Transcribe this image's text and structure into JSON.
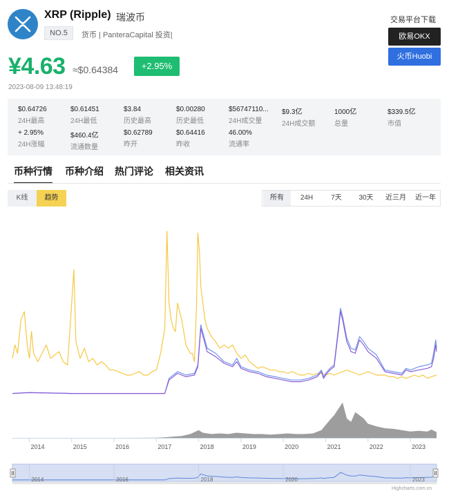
{
  "coin": {
    "name": "XRP (Ripple)",
    "cn_name": "瑞波币",
    "rank": "NO.5",
    "tags": "货币 | PanteraCapital 投资|"
  },
  "price": {
    "cny": "¥4.63",
    "usd": "≈$0.64384",
    "change": "+2.95%",
    "timestamp": "2023-08-09 13:48:19"
  },
  "exchange": {
    "title": "交易平台下载",
    "buttons": [
      "欧易OKX",
      "火币Huobi"
    ]
  },
  "stats": [
    {
      "value": "$0.64726",
      "label": "24H最高"
    },
    {
      "value": "$0.61451",
      "label": "24H最低"
    },
    {
      "value": "$3.84",
      "label": "历史最高"
    },
    {
      "value": "$0.00280",
      "label": "历史最低"
    },
    {
      "value": "$56747110...",
      "label": "24H成交量"
    },
    {
      "value": "$9.3亿",
      "label": "24H成交额"
    },
    {
      "value": "1000亿",
      "label": "总量"
    },
    {
      "value": "$339.5亿",
      "label": "市值"
    },
    {
      "value": "+ 2.95%",
      "label": "24H涨幅"
    },
    {
      "value": "$460.4亿",
      "label": "流通数量"
    },
    {
      "value": "$0.62789",
      "label": "昨开"
    },
    {
      "value": "$0.64416",
      "label": "昨收"
    },
    {
      "value": "46.00%",
      "label": "流通率"
    }
  ],
  "tabs": [
    "币种行情",
    "币种介绍",
    "热门评论",
    "相关资讯"
  ],
  "view_toggle": [
    "K线",
    "趋势"
  ],
  "ranges": [
    "所有",
    "24H",
    "7天",
    "30天",
    "近三月",
    "近一年"
  ],
  "colors": {
    "green": "#19b06b",
    "badge_green": "#1fbd72",
    "yellow": "#f5c842",
    "purple": "#8a5cd8",
    "blue": "#6f96e8",
    "volume": "#999999",
    "navigator_band": "#d2dcf2"
  },
  "chart_data": {
    "type": "line",
    "x_axis_ticks": [
      "2014",
      "2015",
      "2016",
      "2017",
      "2018",
      "2019",
      "2020",
      "2021",
      "2022",
      "2023"
    ],
    "navigator_ticks": [
      "2014",
      "2016",
      "2018",
      "2020",
      "2023"
    ],
    "x_range": [
      2013.6,
      2023.62
    ],
    "y_range": [
      0,
      100
    ],
    "series": [
      {
        "color": "#f5c842",
        "x": [
          2013.6,
          2013.66,
          2013.72,
          2013.8,
          2013.88,
          2013.95,
          2014.0,
          2014.05,
          2014.1,
          2014.2,
          2014.3,
          2014.4,
          2014.5,
          2014.6,
          2014.7,
          2014.8,
          2014.9,
          2015.0,
          2015.05,
          2015.1,
          2015.2,
          2015.3,
          2015.4,
          2015.5,
          2015.6,
          2015.7,
          2015.8,
          2015.9,
          2016.0,
          2016.1,
          2016.2,
          2016.3,
          2016.4,
          2016.5,
          2016.6,
          2016.7,
          2016.8,
          2016.9,
          2017.0,
          2017.1,
          2017.2,
          2017.25,
          2017.3,
          2017.35,
          2017.4,
          2017.45,
          2017.5,
          2017.6,
          2017.7,
          2017.8,
          2017.85,
          2017.9,
          2017.95,
          2017.98,
          2018.02,
          2018.05,
          2018.1,
          2018.15,
          2018.2,
          2018.3,
          2018.4,
          2018.5,
          2018.6,
          2018.7,
          2018.8,
          2018.9,
          2019.0,
          2019.1,
          2019.2,
          2019.3,
          2019.4,
          2019.5,
          2019.6,
          2019.7,
          2019.8,
          2019.9,
          2020.0,
          2020.1,
          2020.2,
          2020.3,
          2020.4,
          2020.5,
          2020.6,
          2020.7,
          2020.8,
          2020.9,
          2021.0,
          2021.1,
          2021.2,
          2021.3,
          2021.4,
          2021.5,
          2021.6,
          2021.7,
          2021.8,
          2021.9,
          2022.0,
          2022.1,
          2022.2,
          2022.3,
          2022.4,
          2022.5,
          2022.6,
          2022.7,
          2022.8,
          2022.9,
          2023.0,
          2023.1,
          2023.2,
          2023.3,
          2023.4,
          2023.5,
          2023.62
        ],
        "values": [
          22,
          30,
          25,
          45,
          50,
          30,
          22,
          38,
          25,
          20,
          25,
          30,
          22,
          24,
          26,
          20,
          18,
          55,
          75,
          32,
          22,
          28,
          20,
          22,
          18,
          20,
          18,
          15,
          15,
          14,
          13,
          12,
          12,
          13,
          14,
          12,
          12,
          14,
          15,
          25,
          40,
          98,
          55,
          45,
          40,
          38,
          55,
          45,
          30,
          25,
          25,
          20,
          55,
          97,
          85,
          65,
          55,
          45,
          40,
          35,
          32,
          28,
          30,
          28,
          30,
          25,
          22,
          24,
          20,
          18,
          16,
          17,
          16,
          15,
          15,
          14,
          14,
          13,
          14,
          13,
          12,
          12,
          13,
          12,
          13,
          13,
          12,
          13,
          12,
          13,
          14,
          15,
          14,
          13,
          12,
          13,
          14,
          13,
          12,
          12,
          12,
          11,
          11,
          10,
          11,
          10,
          11,
          12,
          11,
          12,
          10,
          11,
          12
        ]
      },
      {
        "color": "#6f96e8",
        "x": [
          2013.6,
          2014.0,
          2015.0,
          2016.0,
          2016.9,
          2017.2,
          2017.3,
          2017.5,
          2017.7,
          2017.9,
          2017.98,
          2018.05,
          2018.2,
          2018.4,
          2018.6,
          2018.8,
          2018.9,
          2019.0,
          2019.2,
          2019.4,
          2019.6,
          2019.8,
          2020.0,
          2020.2,
          2020.4,
          2020.6,
          2020.8,
          2020.9,
          2020.95,
          2021.0,
          2021.1,
          2021.2,
          2021.3,
          2021.35,
          2021.4,
          2021.5,
          2021.6,
          2021.7,
          2021.8,
          2021.9,
          2022.0,
          2022.2,
          2022.4,
          2022.6,
          2022.8,
          2022.9,
          2023.0,
          2023.2,
          2023.4,
          2023.5,
          2023.55,
          2023.6,
          2023.62
        ],
        "values": [
          1,
          1.5,
          1,
          1,
          1,
          1,
          10,
          14,
          12,
          13,
          18,
          42,
          28,
          25,
          20,
          18,
          22,
          17,
          15,
          14,
          12,
          11,
          10,
          9,
          9,
          10,
          12,
          15,
          11,
          13,
          16,
          18,
          40,
          52,
          47,
          34,
          28,
          27,
          35,
          32,
          28,
          24,
          15,
          14,
          13,
          16,
          15,
          17,
          18,
          19,
          25,
          33,
          28
        ]
      },
      {
        "color": "#8a5cd8",
        "x": [
          2013.6,
          2014.0,
          2015.0,
          2016.0,
          2016.9,
          2017.2,
          2017.3,
          2017.5,
          2017.7,
          2017.9,
          2017.98,
          2018.05,
          2018.2,
          2018.4,
          2018.6,
          2018.8,
          2018.9,
          2019.0,
          2019.2,
          2019.4,
          2019.6,
          2019.8,
          2020.0,
          2020.2,
          2020.4,
          2020.6,
          2020.8,
          2020.9,
          2020.95,
          2021.0,
          2021.1,
          2021.2,
          2021.3,
          2021.35,
          2021.4,
          2021.5,
          2021.6,
          2021.7,
          2021.8,
          2021.9,
          2022.0,
          2022.2,
          2022.4,
          2022.6,
          2022.8,
          2022.9,
          2023.0,
          2023.2,
          2023.4,
          2023.5,
          2023.55,
          2023.6,
          2023.62
        ],
        "values": [
          1,
          1.5,
          1,
          1,
          1,
          1,
          9,
          13,
          11,
          12,
          17,
          40,
          26,
          23,
          19,
          17,
          20,
          16,
          14,
          13,
          11,
          10,
          9,
          8,
          8,
          9,
          11,
          14,
          10,
          12,
          15,
          17,
          38,
          50,
          45,
          32,
          26,
          25,
          33,
          30,
          26,
          22,
          14,
          13,
          12,
          15,
          14,
          15,
          16,
          17,
          22,
          30,
          26
        ]
      },
      {
        "color": "#999999",
        "x": [
          2013.6,
          2016.0,
          2017.0,
          2017.2,
          2017.4,
          2017.6,
          2017.8,
          2017.9,
          2018.0,
          2018.1,
          2018.3,
          2018.5,
          2018.7,
          2018.9,
          2019.1,
          2019.3,
          2019.5,
          2019.7,
          2019.9,
          2020.1,
          2020.3,
          2020.5,
          2020.7,
          2020.9,
          2021.0,
          2021.1,
          2021.2,
          2021.3,
          2021.4,
          2021.5,
          2021.6,
          2021.7,
          2021.8,
          2021.9,
          2022.0,
          2022.2,
          2022.4,
          2022.6,
          2022.8,
          2023.0,
          2023.2,
          2023.4,
          2023.5,
          2023.62
        ],
        "values": [
          0,
          0,
          0.2,
          1,
          2,
          3,
          6,
          9,
          12,
          8,
          6,
          7,
          6,
          8,
          7,
          6,
          6,
          5,
          6,
          7,
          6,
          6,
          7,
          12,
          20,
          28,
          35,
          45,
          55,
          30,
          25,
          40,
          35,
          30,
          22,
          18,
          15,
          14,
          12,
          10,
          11,
          10,
          13,
          9
        ]
      }
    ]
  }
}
